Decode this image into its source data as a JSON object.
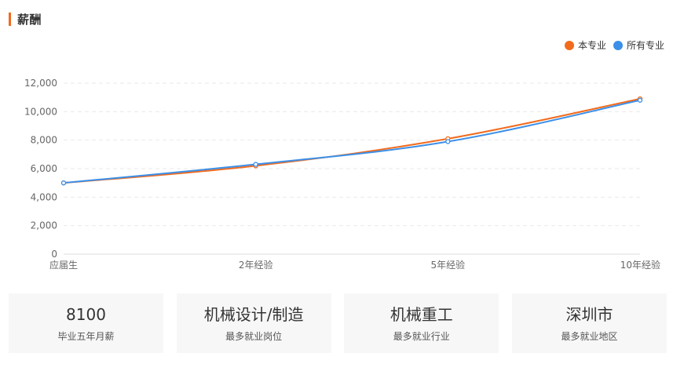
{
  "section": {
    "title": "薪酬"
  },
  "colors": {
    "accent": "#f26b1d",
    "series_major": "#f26b1d",
    "series_all": "#3b8fe8",
    "grid": "#e6e6e6",
    "card_bg": "#f7f7f7"
  },
  "chart_data": {
    "type": "line",
    "categories": [
      "应届生",
      "2年经验",
      "5年经验",
      "10年经验"
    ],
    "series": [
      {
        "name": "本专业",
        "color": "#f26b1d",
        "values": [
          5000,
          6200,
          8100,
          10900
        ]
      },
      {
        "name": "所有专业",
        "color": "#3b8fe8",
        "values": [
          5000,
          6300,
          7900,
          10800
        ]
      }
    ],
    "yticks": [
      "0",
      "2,000",
      "4,000",
      "6,000",
      "8,000",
      "10,000",
      "12,000"
    ],
    "ylim": [
      0,
      12000
    ],
    "grid": true,
    "legend_position": "top-right"
  },
  "stats": [
    {
      "value": "8100",
      "label": "毕业五年月薪"
    },
    {
      "value": "机械设计/制造",
      "label": "最多就业岗位"
    },
    {
      "value": "机械重工",
      "label": "最多就业行业"
    },
    {
      "value": "深圳市",
      "label": "最多就业地区"
    }
  ]
}
